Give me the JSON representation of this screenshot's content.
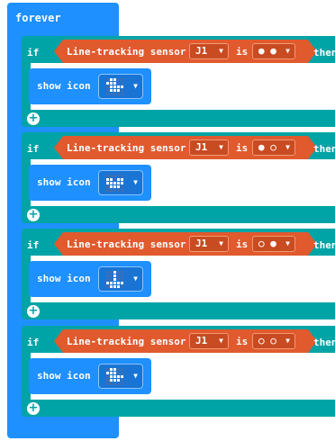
{
  "forever": {
    "label": "forever"
  },
  "blocks": [
    {
      "if_label": "if",
      "condition": {
        "sensor_label": "Line-tracking sensor",
        "pin": "J1",
        "is_label": "is",
        "state": "● ●"
      },
      "then_label": "then",
      "action": {
        "label": "show icon",
        "icon": "duck-icon"
      }
    },
    {
      "if_label": "if",
      "condition": {
        "sensor_label": "Line-tracking sensor",
        "pin": "J1",
        "is_label": "is",
        "state": "● ○"
      },
      "then_label": "then",
      "action": {
        "label": "show icon",
        "icon": "pacman-face-icon"
      }
    },
    {
      "if_label": "if",
      "condition": {
        "sensor_label": "Line-tracking sensor",
        "pin": "J1",
        "is_label": "is",
        "state": "○ ●"
      },
      "then_label": "then",
      "action": {
        "label": "show icon",
        "icon": "boat-icon"
      }
    },
    {
      "if_label": "if",
      "condition": {
        "sensor_label": "Line-tracking sensor",
        "pin": "J1",
        "is_label": "is",
        "state": "○ ○"
      },
      "then_label": "then",
      "action": {
        "label": "show icon",
        "icon": "duck-icon"
      }
    }
  ],
  "colors": {
    "loop": "#1e90ff",
    "logic": "#00a4a6",
    "sensor": "#e05a2e"
  }
}
